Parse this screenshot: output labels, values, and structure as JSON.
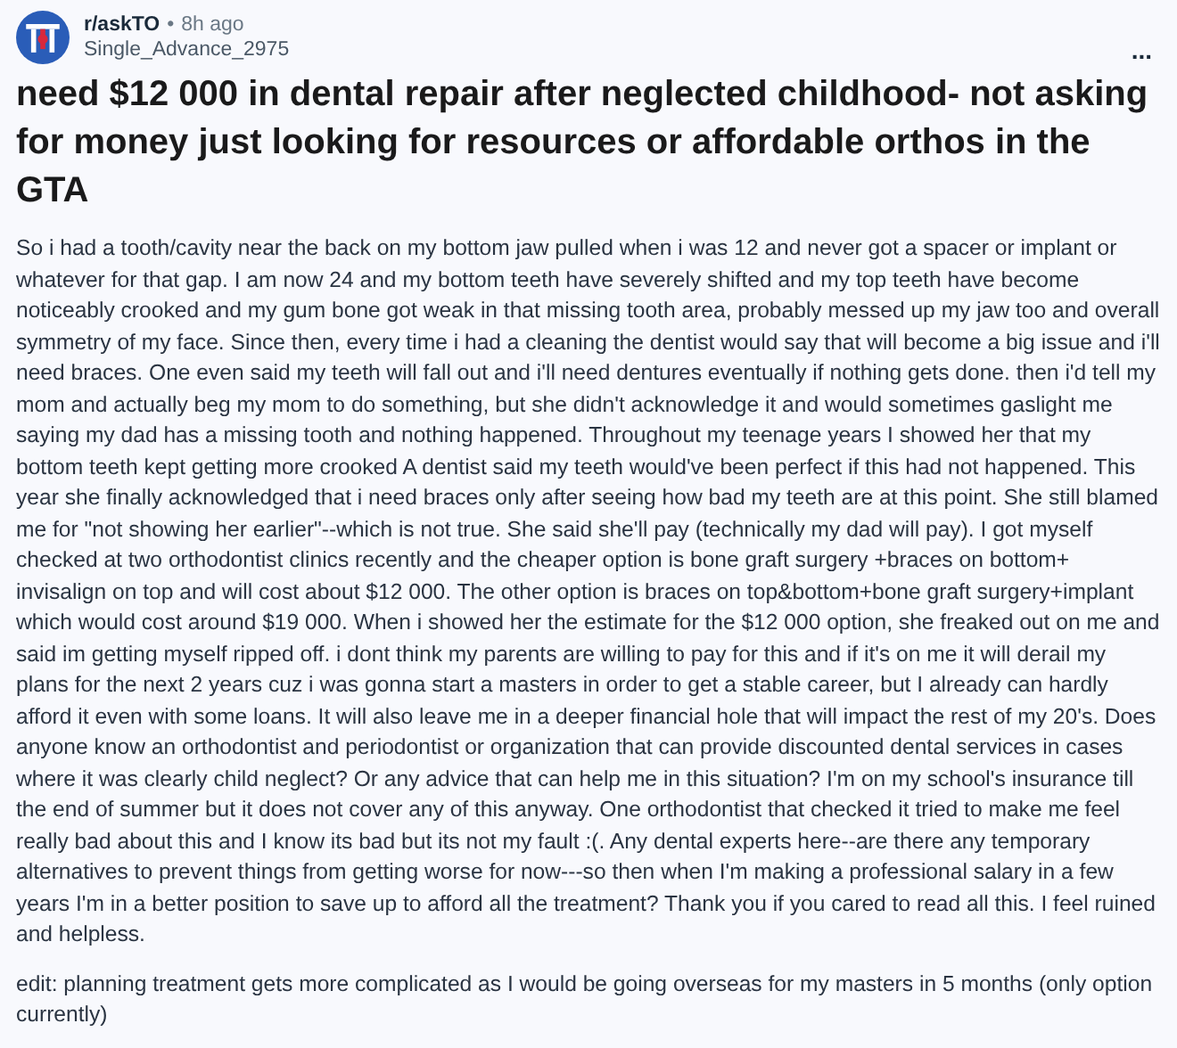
{
  "post": {
    "subreddit": "r/askTO",
    "separator": "•",
    "time": "8h ago",
    "author": "Single_Advance_2975",
    "more_menu": "...",
    "title": "need $12 000 in dental repair after neglected childhood- not asking for money just looking for resources or affordable orthos in the GTA",
    "paragraphs": [
      "So i had a tooth/cavity near the back on my bottom jaw pulled when i was 12 and never got a spacer or implant or whatever for that gap. I am now 24 and my bottom teeth have severely shifted and my top teeth have become noticeably crooked and my gum bone got weak in that missing tooth area, probably messed up my jaw too and overall symmetry of my face. Since then, every time i had a cleaning the dentist would say that will become a big issue and i'll need braces. One even said my teeth will fall out and i'll need dentures eventually if nothing gets done. then i'd tell my mom and actually beg my mom to do something, but she didn't acknowledge it and would sometimes gaslight me saying my dad has a missing tooth and nothing happened. Throughout my teenage years I showed her that my bottom teeth kept getting more crooked A dentist said my teeth would've been perfect if this had not happened. This year she finally acknowledged that i need braces only after seeing how bad my teeth are at this point. She still blamed me for \"not showing her earlier\"--which is not true. She said she'll pay (technically my dad will pay). I got myself checked at two orthodontist clinics recently and the cheaper option is bone graft surgery +braces on bottom+ invisalign on top and will cost about $12 000. The other option is braces on top&bottom+bone graft surgery+implant which would cost around $19 000. When i showed her the estimate for the $12 000 option, she freaked out on me and said im getting myself ripped off. i dont think my parents are willing to pay for this and if it's on me it will derail my plans for the next 2 years cuz i was gonna start a masters in order to get a stable career, but I already can hardly afford it even with some loans. It will also leave me in a deeper financial hole that will impact the rest of my 20's. Does anyone know an orthodontist and periodontist or organization that can provide discounted dental services in cases where it was clearly child neglect? Or any advice that can help me in this situation? I'm on my school's insurance till the end of summer but it does not cover any of this anyway. One orthodontist that checked it tried to make me feel really bad about this and I know its bad but its not my fault :(. Any dental experts here--are there any temporary alternatives to prevent things from getting worse for now---so then when I'm making a professional salary in a few years I'm in a better position to save up to afford all the treatment? Thank you if you cared to read all this. I feel ruined and helpless.",
      "edit: planning treatment gets more complicated as I would be going overseas for my masters in 5 months (only option currently)"
    ]
  }
}
